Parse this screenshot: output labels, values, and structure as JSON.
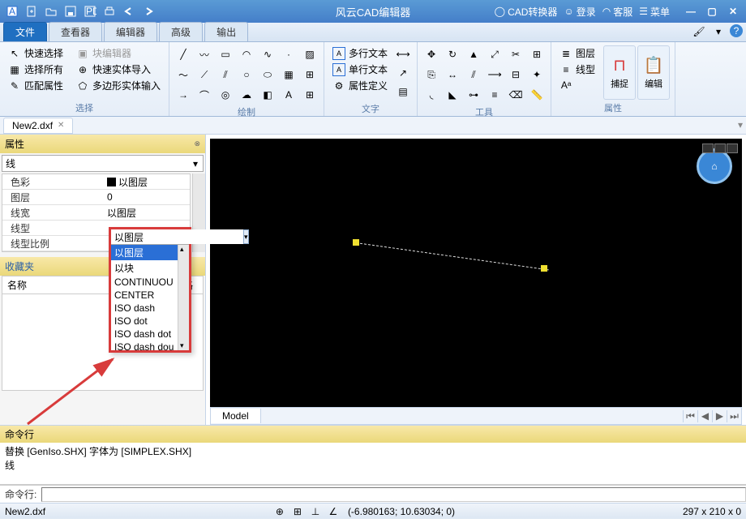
{
  "titlebar": {
    "app_title": "风云CAD编辑器",
    "convert": "CAD转换器",
    "login": "登录",
    "support": "客服",
    "menu": "菜单"
  },
  "tabs": {
    "file": "文件",
    "viewer": "查看器",
    "editor": "编辑器",
    "advanced": "高级",
    "output": "输出"
  },
  "ribbon": {
    "group_select": "选择",
    "quick_select": "快速选择",
    "select_all": "选择所有",
    "match_props": "匹配属性",
    "block_editor": "块编辑器",
    "quick_import": "快速实体导入",
    "poly_input": "多边形实体输入",
    "group_draw": "绘制",
    "group_text": "文字",
    "multiline_text": "多行文本",
    "singleline_text": "单行文本",
    "attr_def": "属性定义",
    "group_tools": "工具",
    "group_props": "属性",
    "layer": "图层",
    "linetype": "线型",
    "snap": "捕捉",
    "edit": "编辑"
  },
  "doc_tab": "New2.dxf",
  "props_panel": {
    "title": "属性",
    "entity_type": "线",
    "rows": {
      "color_k": "色彩",
      "color_v": "以图层",
      "layer_k": "图层",
      "layer_v": "0",
      "lw_k": "线宽",
      "lw_v": "以图层",
      "lt_k": "线型",
      "lts_k": "线型比例"
    }
  },
  "favorites": {
    "title": "收藏夹",
    "name_col": "名称",
    "path_col": "路"
  },
  "dropdown": {
    "current": "以图层",
    "items": [
      "以图层",
      "以块",
      "CONTINUOU",
      "CENTER",
      "ISO dash",
      "ISO dot",
      "ISO dash dot",
      "ISO dash dou"
    ]
  },
  "model_tab": "Model",
  "cmdline": {
    "title": "命令行",
    "history1": "替换 [GenIso.SHX] 字体为 [SIMPLEX.SHX]",
    "history2": "线",
    "prompt": "命令行:"
  },
  "statusbar": {
    "file": "New2.dxf",
    "coords": "(-6.980163; 10.63034; 0)",
    "size": "297 x 210 x 0"
  }
}
